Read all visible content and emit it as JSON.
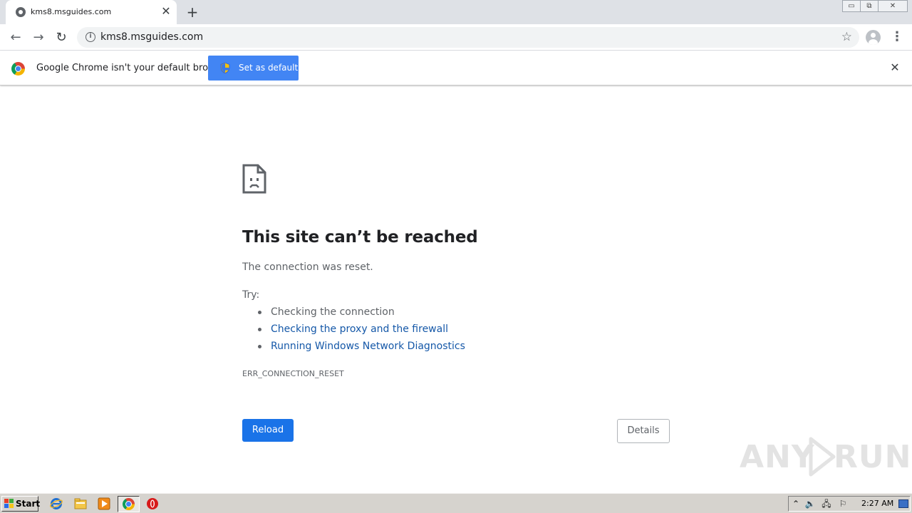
{
  "browser": {
    "tab": {
      "title": "kms8.msguides.com",
      "close_glyph": "✕"
    },
    "new_tab_glyph": "+",
    "window_buttons": {
      "minimize": "▭",
      "restore": "⧉",
      "close": "✕"
    },
    "toolbar": {
      "back_glyph": "←",
      "forward_glyph": "→",
      "reload_glyph": "↻",
      "info_glyph": "i",
      "url": "kms8.msguides.com",
      "bookmark_glyph": "☆",
      "menu_glyph": "⋮"
    },
    "infobar": {
      "message": "Google Chrome isn't your default browser",
      "button_label": "Set as default",
      "close_glyph": "✕"
    }
  },
  "error_page": {
    "title": "This site can’t be reached",
    "subtitle": "The connection was reset.",
    "try_label": "Try:",
    "suggestions": [
      {
        "text": "Checking the connection",
        "link": false
      },
      {
        "text": "Checking the proxy and the firewall",
        "link": true
      },
      {
        "text": "Running Windows Network Diagnostics",
        "link": true
      }
    ],
    "error_code": "ERR_CONNECTION_RESET",
    "reload_label": "Reload",
    "details_label": "Details"
  },
  "watermark": {
    "left": "ANY",
    "right": "RUN"
  },
  "taskbar": {
    "start_label": "Start",
    "clock": "2:27 AM"
  },
  "colors": {
    "accent_blue": "#1a73e8",
    "infobar_button": "#4285f4",
    "link": "#1558a8",
    "text_primary": "#202124",
    "text_secondary": "#5f6368"
  }
}
